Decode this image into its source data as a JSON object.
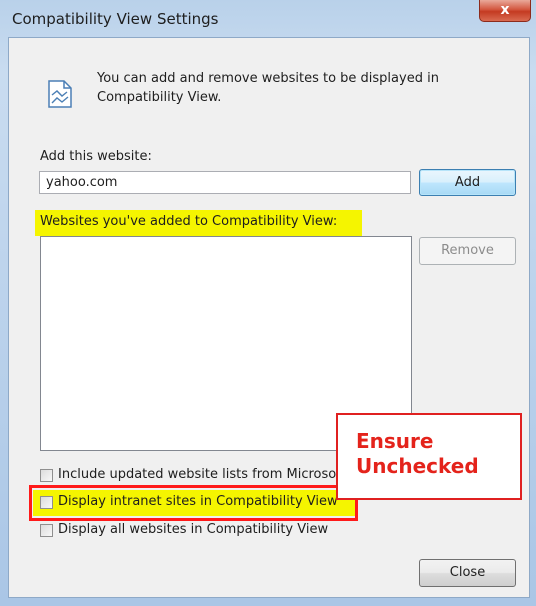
{
  "window": {
    "title": "Compatibility View Settings",
    "close_glyph": "x"
  },
  "info": {
    "icon": "compatibility-view-icon",
    "text": "You can add and remove websites to be displayed in Compatibility View."
  },
  "add_section": {
    "label": "Add this website:",
    "input_value": "yahoo.com",
    "add_button": "Add"
  },
  "list_section": {
    "label": "Websites you've added to Compatibility View:",
    "items": [],
    "remove_button": "Remove"
  },
  "options": [
    {
      "label": "Include updated website lists from Microsoft",
      "checked": false
    },
    {
      "label": "Display intranet sites in Compatibility View",
      "checked": false
    },
    {
      "label": "Display all websites in Compatibility View",
      "checked": false
    }
  ],
  "footer": {
    "close_button": "Close"
  },
  "annotation": {
    "line1": "Ensure",
    "line2": "Unchecked",
    "color": "#e4231b",
    "highlight_color": "#f5f500"
  }
}
